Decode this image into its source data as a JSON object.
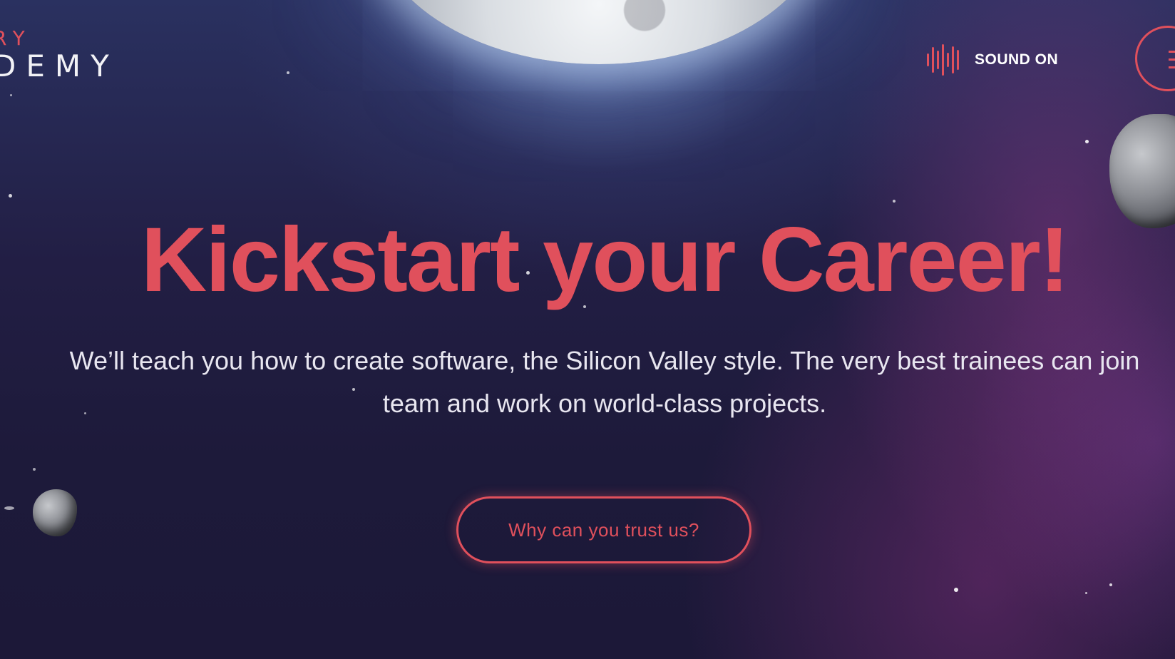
{
  "logo": {
    "line1": "RY",
    "line2": "DEMY"
  },
  "header": {
    "sound_label": "SOUND ON",
    "sound_icon": "sound-wave-icon",
    "menu_icon": "menu-icon"
  },
  "hero": {
    "headline": "Kickstart your Career!",
    "subtitle_line1": "We’ll teach you how to create software, the Silicon Valley style. The very best trainees can join",
    "subtitle_line2": "team and work on world-class projects.",
    "cta_label": "Why can you trust us?"
  },
  "colors": {
    "accent": "#e0505c",
    "background": "#1c1838",
    "text_light": "#e8e6f0"
  }
}
